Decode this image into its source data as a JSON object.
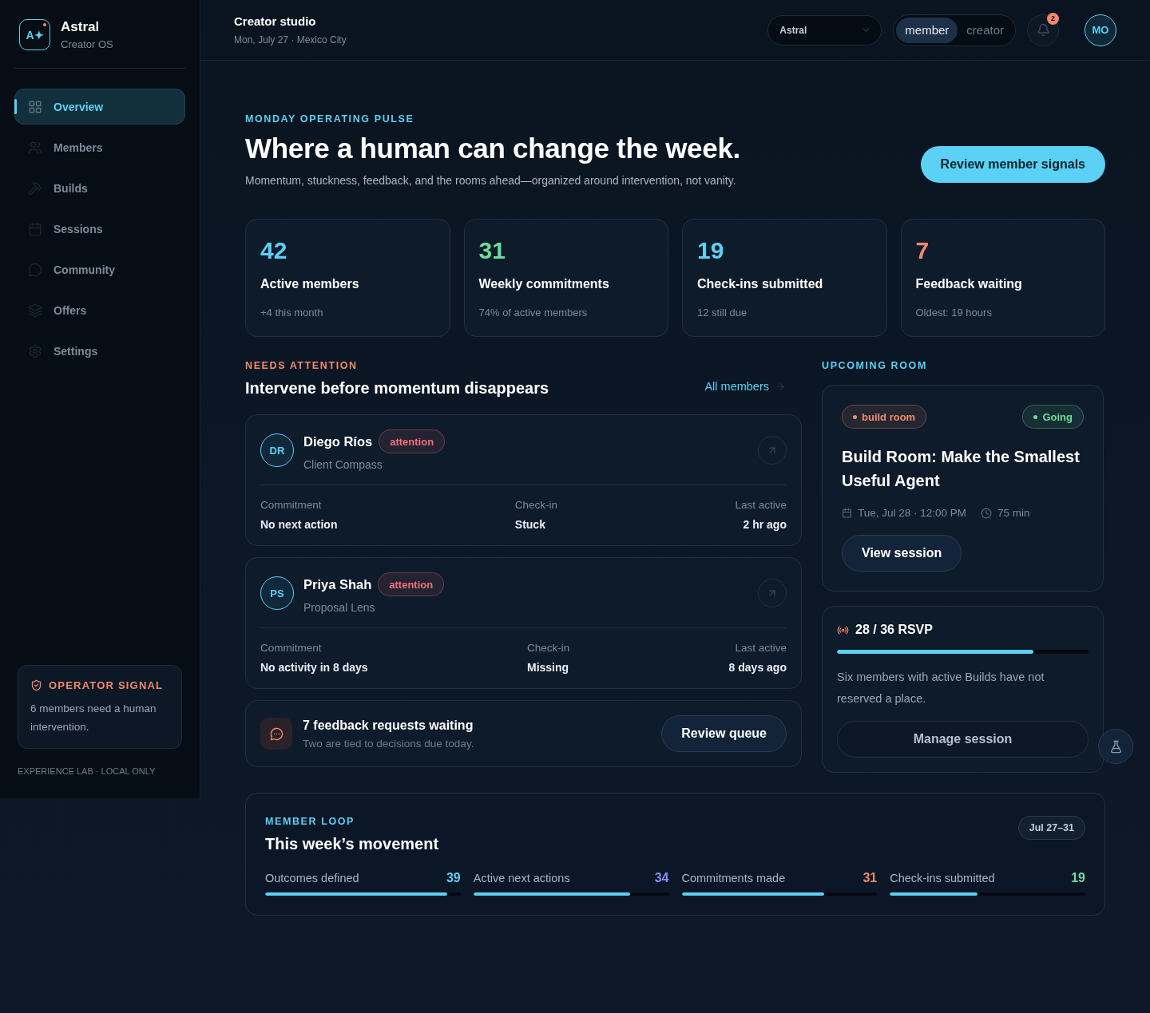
{
  "brand": {
    "logo": "A✦",
    "name": "Astral",
    "subtitle": "Creator OS"
  },
  "nav": [
    {
      "label": "Overview",
      "selected": true
    },
    {
      "label": "Members",
      "selected": false
    },
    {
      "label": "Builds",
      "selected": false
    },
    {
      "label": "Sessions",
      "selected": false
    },
    {
      "label": "Community",
      "selected": false
    },
    {
      "label": "Offers",
      "selected": false
    },
    {
      "label": "Settings",
      "selected": false
    }
  ],
  "operator_signal": {
    "title": "OPERATOR SIGNAL",
    "text": "6 members need a human intervention."
  },
  "footer_note": "EXPERIENCE LAB · LOCAL ONLY",
  "header": {
    "title": "Creator studio",
    "subtitle": "Mon, July 27 · Mexico City",
    "workspace_select": "Astral",
    "role_toggle": [
      {
        "label": "member",
        "selected": true
      },
      {
        "label": "creator",
        "selected": false
      }
    ],
    "notification_count": "2",
    "avatar": "MO"
  },
  "hero": {
    "eyebrow": "MONDAY OPERATING PULSE",
    "title": "Where a human can change the week.",
    "subtitle": "Momentum, stuckness, feedback, and the rooms ahead—organized around intervention, not vanity.",
    "action": "Review member signals"
  },
  "stats": [
    {
      "value": "42",
      "label": "Active members",
      "note": "+4 this month",
      "color": "#5ad1f5"
    },
    {
      "value": "31",
      "label": "Weekly commitments",
      "note": "74% of active members",
      "color": "#6ddc9c"
    },
    {
      "value": "19",
      "label": "Check-ins submitted",
      "note": "12 still due",
      "color": "#5ad1f5"
    },
    {
      "value": "7",
      "label": "Feedback waiting",
      "note": "Oldest: 19 hours",
      "color": "#f08a6b"
    }
  ],
  "attention": {
    "eyebrow": "NEEDS ATTENTION",
    "title": "Intervene before momentum disappears",
    "link": "All members",
    "members": [
      {
        "initials": "DR",
        "name": "Diego Ríos",
        "tag": "attention",
        "project": "Client Compass",
        "fields": [
          {
            "label": "Commitment",
            "value": "No next action"
          },
          {
            "label": "Check-in",
            "value": "Stuck"
          },
          {
            "label": "Last active",
            "value": "2 hr ago"
          }
        ]
      },
      {
        "initials": "PS",
        "name": "Priya Shah",
        "tag": "attention",
        "project": "Proposal Lens",
        "fields": [
          {
            "label": "Commitment",
            "value": "No activity in 8 days"
          },
          {
            "label": "Check-in",
            "value": "Missing"
          },
          {
            "label": "Last active",
            "value": "8 days ago"
          }
        ]
      }
    ],
    "feedback": {
      "title": "7 feedback requests waiting",
      "subtitle": "Two are tied to decisions due today.",
      "action": "Review queue"
    }
  },
  "upcoming": {
    "eyebrow": "UPCOMING ROOM",
    "type_tag": "build room",
    "status_tag": "Going",
    "title": "Build Room: Make the Smallest Useful Agent",
    "date": "Tue, Jul 28 · 12:00 PM",
    "duration": "75 min",
    "action": "View session",
    "rsvp": {
      "text": "28 / 36 RSVP",
      "level": 0.78,
      "note": "Six members with active Builds have not reserved a place.",
      "action": "Manage session"
    }
  },
  "loop": {
    "eyebrow": "MEMBER LOOP",
    "title": "This week’s movement",
    "range": "Jul 27–31",
    "metrics": [
      {
        "label": "Outcomes defined",
        "value": "39",
        "color": "#5ad1f5",
        "level": 0.93
      },
      {
        "label": "Active next actions",
        "value": "34",
        "color": "#8b8cf8",
        "level": 0.8
      },
      {
        "label": "Commitments made",
        "value": "31",
        "color": "#f08a6b",
        "level": 0.73
      },
      {
        "label": "Check-ins submitted",
        "value": "19",
        "color": "#6ddc9c",
        "level": 0.45
      }
    ]
  }
}
